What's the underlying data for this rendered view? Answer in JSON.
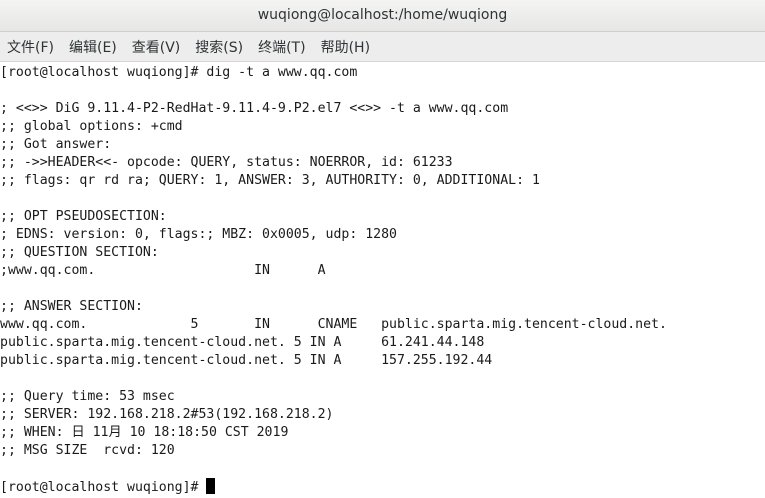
{
  "window": {
    "title": "wuqiong@localhost:/home/wuqiong"
  },
  "menu": [
    {
      "label": "文件(F)"
    },
    {
      "label": "编辑(E)"
    },
    {
      "label": "查看(V)"
    },
    {
      "label": "搜索(S)"
    },
    {
      "label": "终端(T)"
    },
    {
      "label": "帮助(H)"
    }
  ],
  "terminal": {
    "lines": [
      "[root@localhost wuqiong]# dig -t a www.qq.com",
      "",
      "; <<>> DiG 9.11.4-P2-RedHat-9.11.4-9.P2.el7 <<>> -t a www.qq.com",
      ";; global options: +cmd",
      ";; Got answer:",
      ";; ->>HEADER<<- opcode: QUERY, status: NOERROR, id: 61233",
      ";; flags: qr rd ra; QUERY: 1, ANSWER: 3, AUTHORITY: 0, ADDITIONAL: 1",
      "",
      ";; OPT PSEUDOSECTION:",
      "; EDNS: version: 0, flags:; MBZ: 0x0005, udp: 1280",
      ";; QUESTION SECTION:",
      ";www.qq.com.                    IN      A",
      "",
      ";; ANSWER SECTION:",
      "www.qq.com.             5       IN      CNAME   public.sparta.mig.tencent-cloud.net.",
      "public.sparta.mig.tencent-cloud.net. 5 IN A     61.241.44.148",
      "public.sparta.mig.tencent-cloud.net. 5 IN A     157.255.192.44",
      "",
      ";; Query time: 53 msec",
      ";; SERVER: 192.168.218.2#53(192.168.218.2)",
      ";; WHEN: 日 11月 10 18:18:50 CST 2019",
      ";; MSG SIZE  rcvd: 120",
      "",
      "[root@localhost wuqiong]# "
    ]
  }
}
